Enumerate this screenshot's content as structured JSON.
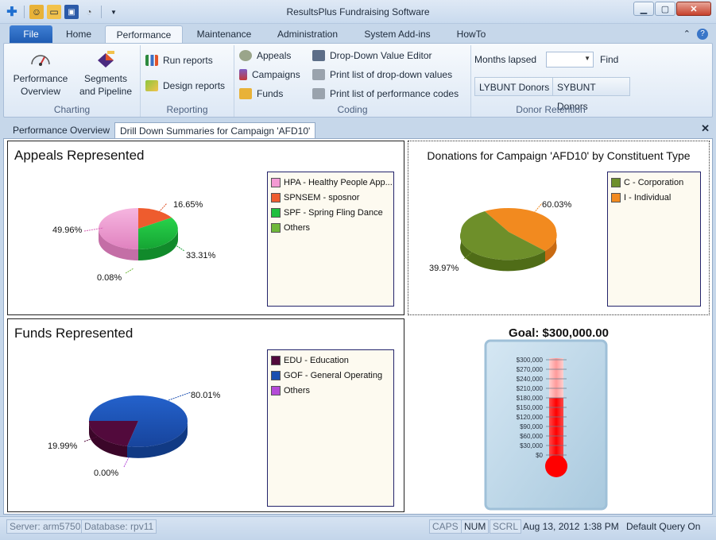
{
  "window": {
    "title": "ResultsPlus Fundraising Software"
  },
  "tabs": [
    "File",
    "Home",
    "Performance",
    "Maintenance",
    "Administration",
    "System Add-ins",
    "HowTo"
  ],
  "ribbon": {
    "charting": {
      "label": "Charting",
      "performance_overview": "Performance Overview",
      "segments": "Segments and Pipeline"
    },
    "reporting": {
      "label": "Reporting",
      "run_reports": "Run reports",
      "design_reports": "Design reports"
    },
    "coding": {
      "label": "Coding",
      "appeals": "Appeals",
      "campaigns": "Campaigns",
      "funds": "Funds",
      "dropdown_editor": "Drop-Down Value Editor",
      "print_dropdown": "Print list of drop-down values",
      "print_perf": "Print list of performance codes"
    },
    "donor_retention": {
      "label": "Donor Retention",
      "months_lapsed": "Months lapsed",
      "months_value": "",
      "find": "Find",
      "lybunt": "LYBUNT Donors",
      "sybunt": "SYBUNT Donors"
    }
  },
  "doc_tabs": [
    "Performance Overview",
    "Drill Down Summaries for Campaign 'AFD10'"
  ],
  "panels": {
    "appeals": {
      "title": "Appeals Represented",
      "legend": [
        "HPA - Healthy People App...",
        "SPNSEM - sposnor",
        "SPF - Spring Fling Dance",
        "Others"
      ],
      "labels": [
        "49.96%",
        "16.65%",
        "33.31%",
        "0.08%"
      ]
    },
    "constituent": {
      "title": "Donations for Campaign 'AFD10' by Constituent Type",
      "legend": [
        "C - Corporation",
        "I - Individual"
      ],
      "labels": [
        "60.03%",
        "39.97%"
      ]
    },
    "funds": {
      "title": "Funds Represented",
      "legend": [
        "EDU - Education",
        "GOF - General Operating",
        "Others"
      ],
      "labels": [
        "80.01%",
        "19.99%",
        "0.00%"
      ]
    },
    "goal": {
      "title": "Goal: $300,000.00",
      "ticks": [
        "$300,000",
        "$270,000",
        "$240,000",
        "$210,000",
        "$180,000",
        "$150,000",
        "$120,000",
        "$90,000",
        "$60,000",
        "$30,000",
        "$0"
      ],
      "fill_fraction": 0.6
    }
  },
  "statusbar": {
    "server": "Server: arm5750",
    "database": "Database: rpv11",
    "caps": "CAPS",
    "num": "NUM",
    "scrl": "SCRL",
    "date": "Aug 13, 2012",
    "time": "1:38 PM",
    "query": "Default Query On"
  },
  "colors": {
    "hpa": "#f39ad3",
    "spnsem": "#ee5c2e",
    "spf": "#1fbf3e",
    "others_green": "#6fb83a",
    "corp": "#6e8f2a",
    "indiv": "#f28a1f",
    "edu": "#520a3c",
    "gof": "#1a4eb0",
    "others_purple": "#b44ad8",
    "thermo": "#ff1a1a"
  }
}
